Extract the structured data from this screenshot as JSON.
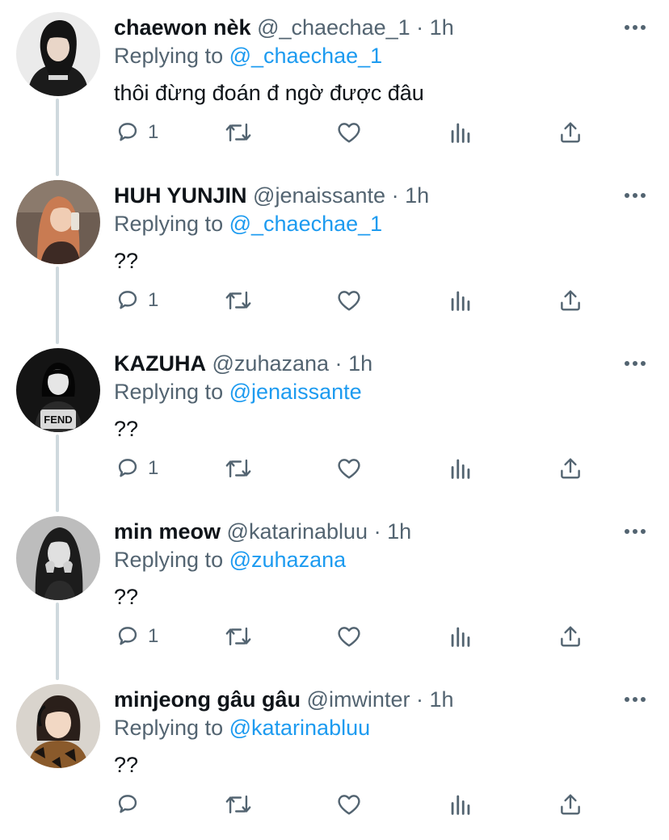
{
  "colors": {
    "accent": "#1d9bf0",
    "secondary_text": "#536471",
    "primary_text": "#0f1419",
    "thread_line": "#cfd9de"
  },
  "icons": {
    "reply": "reply-icon",
    "retweet": "retweet-icon",
    "like": "heart-icon",
    "views": "views-icon",
    "share": "share-icon",
    "more": "more-icon"
  },
  "tweets": [
    {
      "display_name": "chaewon nèk",
      "handle": "@_chaechae_1",
      "separator": "·",
      "time": "1h",
      "replying_prefix": "Replying to",
      "replying_to": "@_chaechae_1",
      "text": "thôi đừng đoán đ ngờ được đâu",
      "reply_count": "1"
    },
    {
      "display_name": "HUH YUNJIN",
      "handle": "@jenaissante",
      "separator": "·",
      "time": "1h",
      "replying_prefix": "Replying to",
      "replying_to": "@_chaechae_1",
      "text": "??",
      "reply_count": "1"
    },
    {
      "display_name": "KAZUHA",
      "handle": "@zuhazana",
      "separator": "·",
      "time": "1h",
      "replying_prefix": "Replying to",
      "replying_to": "@jenaissante",
      "text": "??",
      "reply_count": "1"
    },
    {
      "display_name": "min meow",
      "handle": "@katarinabluu",
      "separator": "·",
      "time": "1h",
      "replying_prefix": "Replying to",
      "replying_to": "@zuhazana",
      "text": "??",
      "reply_count": "1"
    },
    {
      "display_name": "minjeong gâu gâu",
      "handle": "@imwinter",
      "separator": "·",
      "time": "1h",
      "replying_prefix": "Replying to",
      "replying_to": "@katarinabluu",
      "text": "??",
      "reply_count": ""
    }
  ]
}
